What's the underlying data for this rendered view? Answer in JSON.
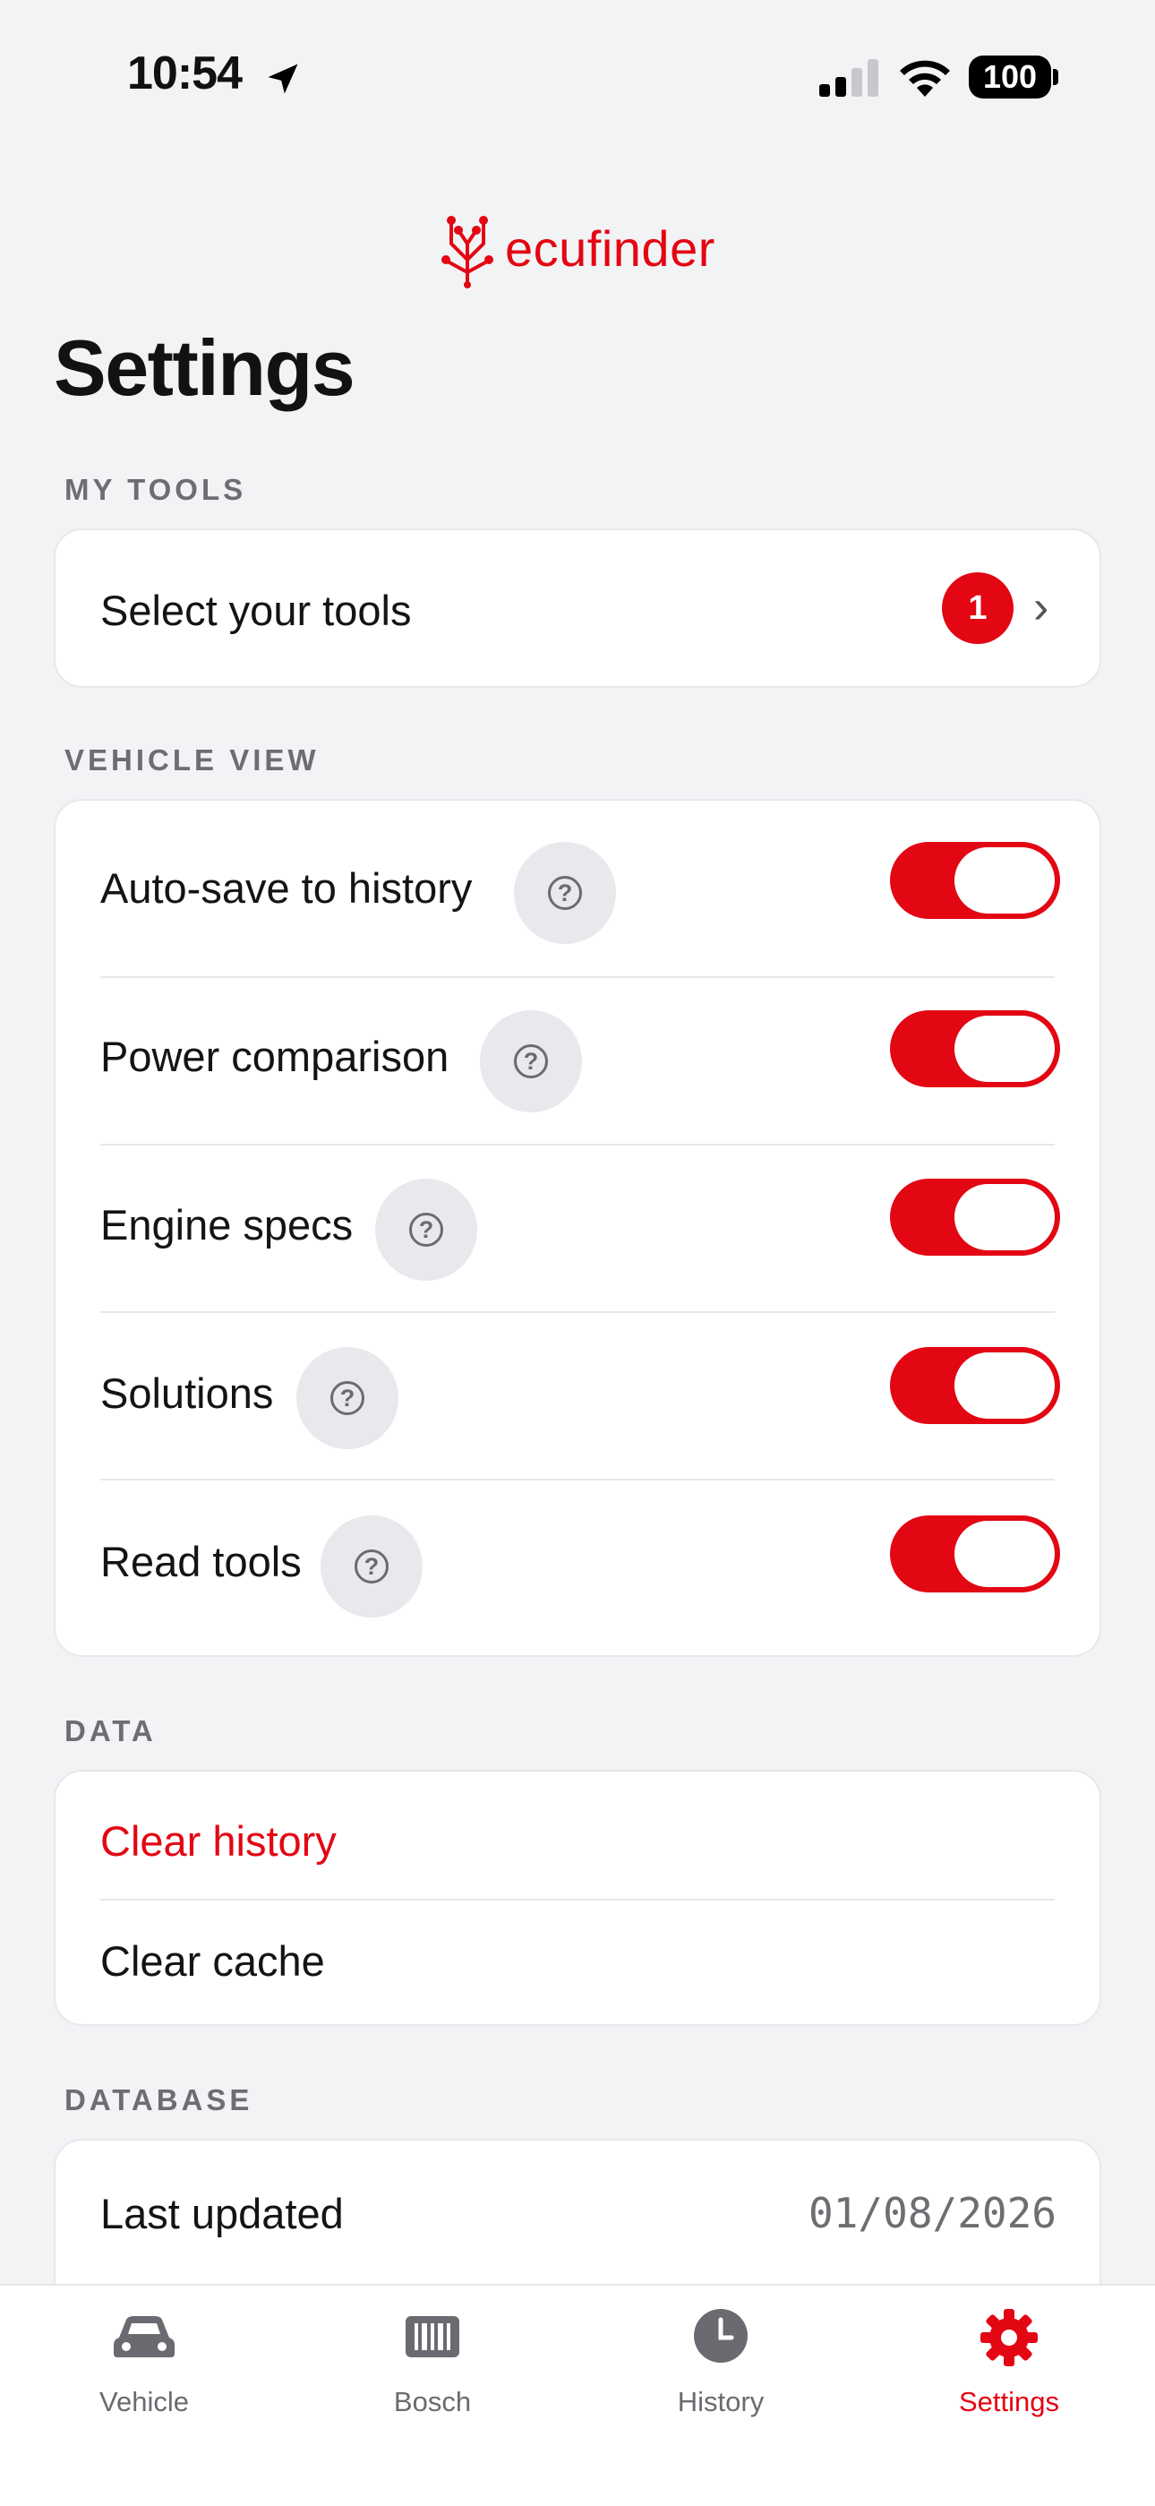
{
  "status_bar": {
    "time": "10:54",
    "battery": "100"
  },
  "brand": {
    "logo_text": "ecufinder",
    "accent": "#e30613"
  },
  "page": {
    "title": "Settings"
  },
  "my_tools": {
    "header": "MY TOOLS",
    "select_label": "Select your tools",
    "badge_count": "1"
  },
  "vehicle_view": {
    "header": "VEHICLE VIEW",
    "items": [
      {
        "label": "Auto-save to history",
        "enabled": true
      },
      {
        "label": "Power comparison",
        "enabled": true
      },
      {
        "label": "Engine specs",
        "enabled": true
      },
      {
        "label": "Solutions",
        "enabled": true
      },
      {
        "label": "Read tools",
        "enabled": true
      }
    ]
  },
  "data": {
    "header": "DATA",
    "clear_history": "Clear history",
    "clear_cache": "Clear cache"
  },
  "database": {
    "header": "DATABASE",
    "last_updated_label": "Last updated",
    "last_updated_value": "01/08/2026"
  },
  "tabs": [
    {
      "label": "Vehicle",
      "icon": "car-icon",
      "active": false
    },
    {
      "label": "Bosch",
      "icon": "barcode-icon",
      "active": false
    },
    {
      "label": "History",
      "icon": "clock-icon",
      "active": false
    },
    {
      "label": "Settings",
      "icon": "gear-icon",
      "active": true
    }
  ]
}
